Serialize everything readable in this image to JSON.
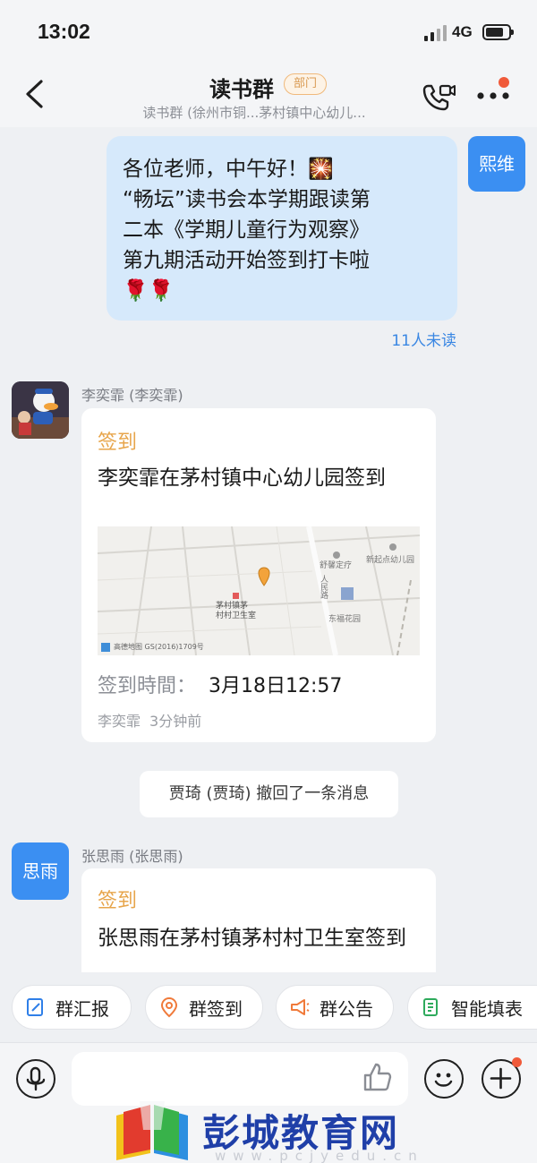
{
  "status_bar": {
    "time": "13:02",
    "network": "4G",
    "battery_level": 0.8
  },
  "header": {
    "title": "读书群",
    "badge": "部门",
    "subtitle": "读书群 (徐州市铜...茅村镇中心幼儿..."
  },
  "messages": {
    "self": {
      "avatar_label": "熙维",
      "lines": [
        "各位老师，中午好！🎇",
        "“畅坛”读书会本学期跟读第",
        "二本《学期儿童行为观察》",
        "第九期活动开始签到打卡啦",
        "🌹🌹"
      ],
      "unread": "11人未读"
    },
    "checkin_1": {
      "sender": "李奕霏 (李奕霏)",
      "tag": "签到",
      "text": "李奕霏在茅村镇中心幼儿园签到",
      "map_labels": {
        "pin_place": "茅村镇茅\n村村卫生室",
        "poi_1": "舒馨定疗",
        "poi_2": "新起点幼儿园",
        "road": "人民路",
        "poi_3": "东福花园",
        "map_credit": "高德地图 GS(2016)1709号"
      },
      "time_label": "签到時間：",
      "time_value": "3月18日12:57",
      "footer_name": "李奕霏",
      "footer_ago": "3分钟前"
    },
    "system_notice": "贾琦 (贾琦) 撤回了一条消息",
    "checkin_2": {
      "sender": "张思雨 (张思雨)",
      "avatar_label": "思雨",
      "tag": "签到",
      "text": "张思雨在茅村镇茅村村卫生室签到"
    }
  },
  "quick_actions": [
    "群汇报",
    "群签到",
    "群公告",
    "智能填表"
  ],
  "input": {
    "placeholder": ""
  },
  "watermark": {
    "text": "彭城教育网",
    "url": "www.pcjyedu.cn"
  },
  "colors": {
    "accent": "#3b8ff2",
    "tag": "#e7a54b",
    "bubble_self": "#d6e9fb",
    "badge": "#d99a52"
  }
}
